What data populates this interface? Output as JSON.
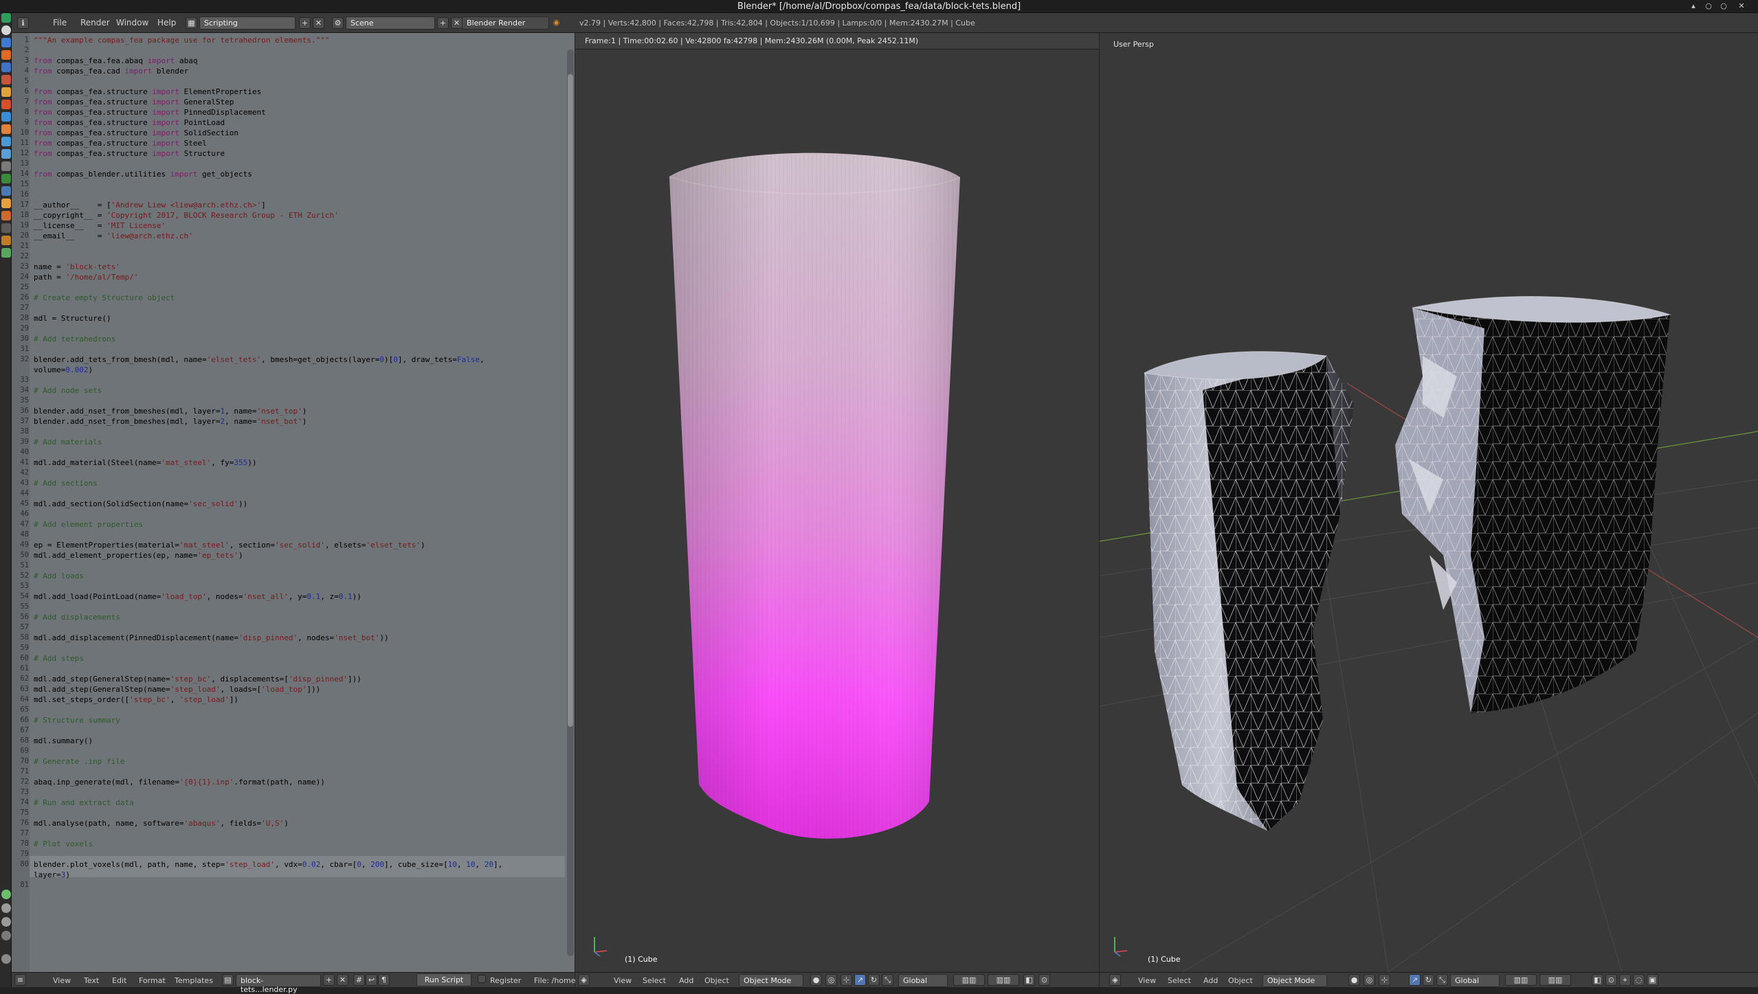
{
  "window": {
    "title": "Blender* [/home/al/Dropbox/compas_fea/data/block-tets.blend]",
    "controls": [
      "▴",
      "○",
      "○",
      "✕"
    ]
  },
  "menu": {
    "items": [
      "File",
      "Render",
      "Window",
      "Help"
    ],
    "screen_layout": "Scripting",
    "scene": "Scene",
    "render_engine": "Blender Render",
    "stats": "v2.79 | Verts:42,800 | Faces:42,798 | Tris:42,804 | Objects:1/10,699 | Lamps:0/0 | Mem:2430.27M | Cube"
  },
  "text_editor": {
    "lines": [
      {
        "n": "1",
        "h": "<span class=\"str\">\"\"\"An example compas_fea package use for tetrahedron elements.\"\"\"</span>"
      },
      {
        "n": "2",
        "h": ""
      },
      {
        "n": "3",
        "h": "<span class=\"kw\">from</span> compas_fea.fea.abaq <span class=\"kw\">import</span> abaq"
      },
      {
        "n": "4",
        "h": "<span class=\"kw\">from</span> compas_fea.cad <span class=\"kw\">import</span> blender"
      },
      {
        "n": "5",
        "h": ""
      },
      {
        "n": "6",
        "h": "<span class=\"kw\">from</span> compas_fea.structure <span class=\"kw\">import</span> ElementProperties"
      },
      {
        "n": "7",
        "h": "<span class=\"kw\">from</span> compas_fea.structure <span class=\"kw\">import</span> GeneralStep"
      },
      {
        "n": "8",
        "h": "<span class=\"kw\">from</span> compas_fea.structure <span class=\"kw\">import</span> PinnedDisplacement"
      },
      {
        "n": "9",
        "h": "<span class=\"kw\">from</span> compas_fea.structure <span class=\"kw\">import</span> PointLoad"
      },
      {
        "n": "10",
        "h": "<span class=\"kw\">from</span> compas_fea.structure <span class=\"kw\">import</span> SolidSection"
      },
      {
        "n": "11",
        "h": "<span class=\"kw\">from</span> compas_fea.structure <span class=\"kw\">import</span> Steel"
      },
      {
        "n": "12",
        "h": "<span class=\"kw\">from</span> compas_fea.structure <span class=\"kw\">import</span> Structure"
      },
      {
        "n": "13",
        "h": ""
      },
      {
        "n": "14",
        "h": "<span class=\"kw\">from</span> compas_blender.utilities <span class=\"kw\">import</span> get_objects"
      },
      {
        "n": "15",
        "h": ""
      },
      {
        "n": "16",
        "h": ""
      },
      {
        "n": "17",
        "h": "__author__    = [<span class=\"str\">'Andrew Liew &lt;liew@arch.ethz.ch&gt;'</span>]"
      },
      {
        "n": "18",
        "h": "__copyright__ = <span class=\"str\">'Copyright 2017, BLOCK Research Group - ETH Zurich'</span>"
      },
      {
        "n": "19",
        "h": "__license__   = <span class=\"str\">'MIT License'</span>"
      },
      {
        "n": "20",
        "h": "__email__     = <span class=\"str\">'liew@arch.ethz.ch'</span>"
      },
      {
        "n": "21",
        "h": ""
      },
      {
        "n": "22",
        "h": ""
      },
      {
        "n": "23",
        "h": "name = <span class=\"str\">'block-tets'</span>"
      },
      {
        "n": "24",
        "h": "path = <span class=\"str\">'/home/al/Temp/'</span>"
      },
      {
        "n": "25",
        "h": ""
      },
      {
        "n": "26",
        "h": "<span class=\"cm\"># Create empty Structure object</span>"
      },
      {
        "n": "27",
        "h": ""
      },
      {
        "n": "28",
        "h": "mdl = Structure()"
      },
      {
        "n": "29",
        "h": ""
      },
      {
        "n": "30",
        "h": "<span class=\"cm\"># Add tetrahedrons</span>"
      },
      {
        "n": "31",
        "h": ""
      },
      {
        "n": "32",
        "h": "blender.add_tets_from_bmesh(mdl, name=<span class=\"str\">'elset_tets'</span>, bmesh=get_objects(layer=<span class=\"num\">0</span>)[<span class=\"num\">0</span>], draw_tets=<span class=\"num\">False</span>,"
      },
      {
        "n": "",
        "h": "volume=<span class=\"num\">0.002</span>)"
      },
      {
        "n": "33",
        "h": ""
      },
      {
        "n": "34",
        "h": "<span class=\"cm\"># Add node sets</span>"
      },
      {
        "n": "35",
        "h": ""
      },
      {
        "n": "36",
        "h": "blender.add_nset_from_bmeshes(mdl, layer=<span class=\"num\">1</span>, name=<span class=\"str\">'nset_top'</span>)"
      },
      {
        "n": "37",
        "h": "blender.add_nset_from_bmeshes(mdl, layer=<span class=\"num\">2</span>, name=<span class=\"str\">'nset_bot'</span>)"
      },
      {
        "n": "38",
        "h": ""
      },
      {
        "n": "39",
        "h": "<span class=\"cm\"># Add materials</span>"
      },
      {
        "n": "40",
        "h": ""
      },
      {
        "n": "41",
        "h": "mdl.add_material(Steel(name=<span class=\"str\">'mat_steel'</span>, fy=<span class=\"num\">355</span>))"
      },
      {
        "n": "42",
        "h": ""
      },
      {
        "n": "43",
        "h": "<span class=\"cm\"># Add sections</span>"
      },
      {
        "n": "44",
        "h": ""
      },
      {
        "n": "45",
        "h": "mdl.add_section(SolidSection(name=<span class=\"str\">'sec_solid'</span>))"
      },
      {
        "n": "46",
        "h": ""
      },
      {
        "n": "47",
        "h": "<span class=\"cm\"># Add element properties</span>"
      },
      {
        "n": "48",
        "h": ""
      },
      {
        "n": "49",
        "h": "ep = ElementProperties(material=<span class=\"str\">'mat_steel'</span>, section=<span class=\"str\">'sec_solid'</span>, elsets=<span class=\"str\">'elset_tets'</span>)"
      },
      {
        "n": "50",
        "h": "mdl.add_element_properties(ep, name=<span class=\"str\">'ep_tets'</span>)"
      },
      {
        "n": "51",
        "h": ""
      },
      {
        "n": "52",
        "h": "<span class=\"cm\"># Add loads</span>"
      },
      {
        "n": "53",
        "h": ""
      },
      {
        "n": "54",
        "h": "mdl.add_load(PointLoad(name=<span class=\"str\">'load_top'</span>, nodes=<span class=\"str\">'nset_all'</span>, y=<span class=\"num\">0.1</span>, z=<span class=\"num\">0.1</span>))"
      },
      {
        "n": "55",
        "h": ""
      },
      {
        "n": "56",
        "h": "<span class=\"cm\"># Add displacements</span>"
      },
      {
        "n": "57",
        "h": ""
      },
      {
        "n": "58",
        "h": "mdl.add_displacement(PinnedDisplacement(name=<span class=\"str\">'disp_pinned'</span>, nodes=<span class=\"str\">'nset_bot'</span>))"
      },
      {
        "n": "59",
        "h": ""
      },
      {
        "n": "60",
        "h": "<span class=\"cm\"># Add steps</span>"
      },
      {
        "n": "61",
        "h": ""
      },
      {
        "n": "62",
        "h": "mdl.add_step(GeneralStep(name=<span class=\"str\">'step_bc'</span>, displacements=[<span class=\"str\">'disp_pinned'</span>]))"
      },
      {
        "n": "63",
        "h": "mdl.add_step(GeneralStep(name=<span class=\"str\">'step_load'</span>, loads=[<span class=\"str\">'load_top'</span>]))"
      },
      {
        "n": "64",
        "h": "mdl.set_steps_order([<span class=\"str\">'step_bc'</span>, <span class=\"str\">'step_load'</span>])"
      },
      {
        "n": "65",
        "h": ""
      },
      {
        "n": "66",
        "h": "<span class=\"cm\"># Structure summary</span>"
      },
      {
        "n": "67",
        "h": ""
      },
      {
        "n": "68",
        "h": "mdl.summary()"
      },
      {
        "n": "69",
        "h": ""
      },
      {
        "n": "70",
        "h": "<span class=\"cm\"># Generate .inp file</span>"
      },
      {
        "n": "71",
        "h": ""
      },
      {
        "n": "72",
        "h": "abaq.inp_generate(mdl, filename=<span class=\"str\">'{0}{1}.inp'</span>.format(path, name))"
      },
      {
        "n": "73",
        "h": ""
      },
      {
        "n": "74",
        "h": "<span class=\"cm\"># Run and extract data</span>"
      },
      {
        "n": "75",
        "h": ""
      },
      {
        "n": "76",
        "h": "mdl.analyse(path, name, software=<span class=\"str\">'abaqus'</span>, fields=<span class=\"str\">'U,S'</span>)"
      },
      {
        "n": "77",
        "h": ""
      },
      {
        "n": "78",
        "h": "<span class=\"cm\"># Plot voxels</span>"
      },
      {
        "n": "79",
        "h": ""
      },
      {
        "n": "80",
        "h": "blender.plot_voxels(mdl, path, name, step=<span class=\"str\">'step_load'</span>, vdx=<span class=\"num\">0.02</span>, cbar=[<span class=\"num\">0</span>, <span class=\"num\">200</span>], cube_size=[<span class=\"num\">10</span>, <span class=\"num\">10</span>, <span class=\"num\">20</span>],"
      },
      {
        "n": "",
        "h": "layer=<span class=\"num\">3</span>)"
      },
      {
        "n": "81",
        "h": ""
      }
    ],
    "footer": {
      "menus": [
        "View",
        "Text",
        "Edit",
        "Format",
        "Templates"
      ],
      "filename": "block-tets...lender.py",
      "run_button": "Run Script",
      "register": "Register",
      "file_path": "File: /home/"
    }
  },
  "viewport_left": {
    "info": "Frame:1 | Time:00:02.60 | Ve:42800 fa:42798 | Mem:2430.26M (0.00M, Peak 2452.11M)",
    "object_label": "(1) Cube",
    "footer": {
      "menus": [
        "View",
        "Select",
        "Add",
        "Object"
      ],
      "mode": "Object Mode",
      "orientation": "Global"
    }
  },
  "viewport_right": {
    "info": "User Persp",
    "object_label": "(1) Cube",
    "footer": {
      "menus": [
        "View",
        "Select",
        "Add",
        "Object"
      ],
      "mode": "Object Mode",
      "orientation": "Global"
    }
  },
  "colors": {
    "accent": "#ff4dff",
    "mesh_light": "#c8cad4",
    "mesh_dark": "#0b0b0b"
  }
}
